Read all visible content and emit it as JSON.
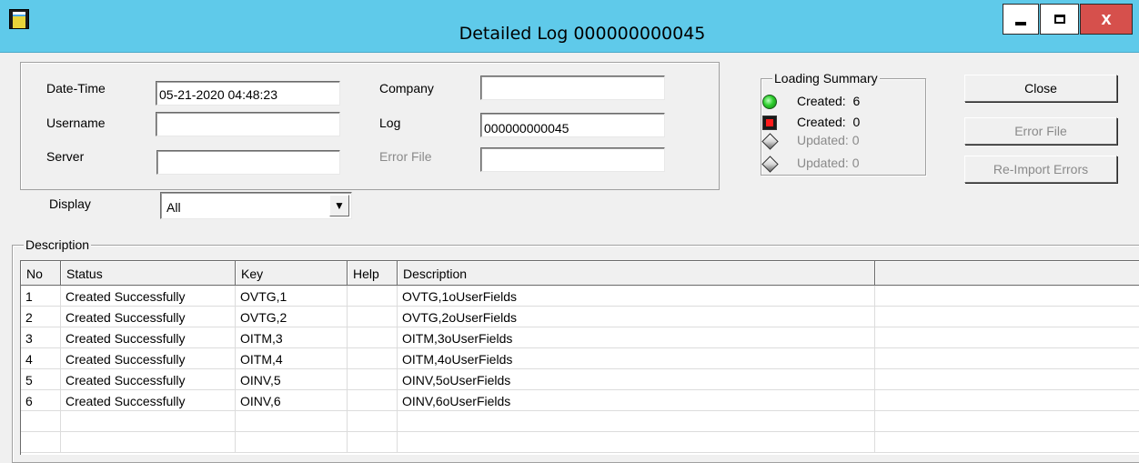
{
  "window": {
    "title": "Detailed Log 000000000045",
    "close_glyph": "x"
  },
  "form": {
    "datetime_label": "Date-Time",
    "datetime_value": "05-21-2020 04:48:23",
    "username_label": "Username",
    "username_value": "",
    "server_label": "Server",
    "server_value": "",
    "company_label": "Company",
    "company_value": "",
    "log_label": "Log",
    "log_value": "000000000045",
    "errorfile_label": "Error File",
    "errorfile_value": "",
    "display_label": "Display",
    "display_value": "All"
  },
  "loading_summary": {
    "title": "Loading Summary",
    "items": [
      {
        "icon": "green-led-icon",
        "label": "Created:",
        "count": "6"
      },
      {
        "icon": "red-led-icon",
        "label": "Created:",
        "count": "0"
      },
      {
        "icon": "grey-diamond-icon",
        "label": "Updated:",
        "count": "0"
      },
      {
        "icon": "grey-diamond-icon",
        "label": "Updated:",
        "count": "0"
      }
    ]
  },
  "buttons": {
    "close": "Close",
    "error_file": "Error File",
    "reimport": "Re-Import Errors"
  },
  "description": {
    "title": "Description",
    "columns": [
      "No",
      "Status",
      "Key",
      "Help",
      "Description",
      ""
    ],
    "rows": [
      {
        "no": "1",
        "status": "Created Successfully",
        "key": "OVTG,1",
        "help": "",
        "description": "OVTG,1oUserFields"
      },
      {
        "no": "2",
        "status": "Created Successfully",
        "key": "OVTG,2",
        "help": "",
        "description": "OVTG,2oUserFields"
      },
      {
        "no": "3",
        "status": "Created Successfully",
        "key": "OITM,3",
        "help": "",
        "description": "OITM,3oUserFields"
      },
      {
        "no": "4",
        "status": "Created Successfully",
        "key": "OITM,4",
        "help": "",
        "description": "OITM,4oUserFields"
      },
      {
        "no": "5",
        "status": "Created Successfully",
        "key": "OINV,5",
        "help": "",
        "description": "OINV,5oUserFields"
      },
      {
        "no": "6",
        "status": "Created Successfully",
        "key": "OINV,6",
        "help": "",
        "description": "OINV,6oUserFields"
      }
    ]
  },
  "colors": {
    "titlebar": "#5fcaea",
    "close_button": "#d6504c",
    "window_bg": "#f0f0f0"
  }
}
